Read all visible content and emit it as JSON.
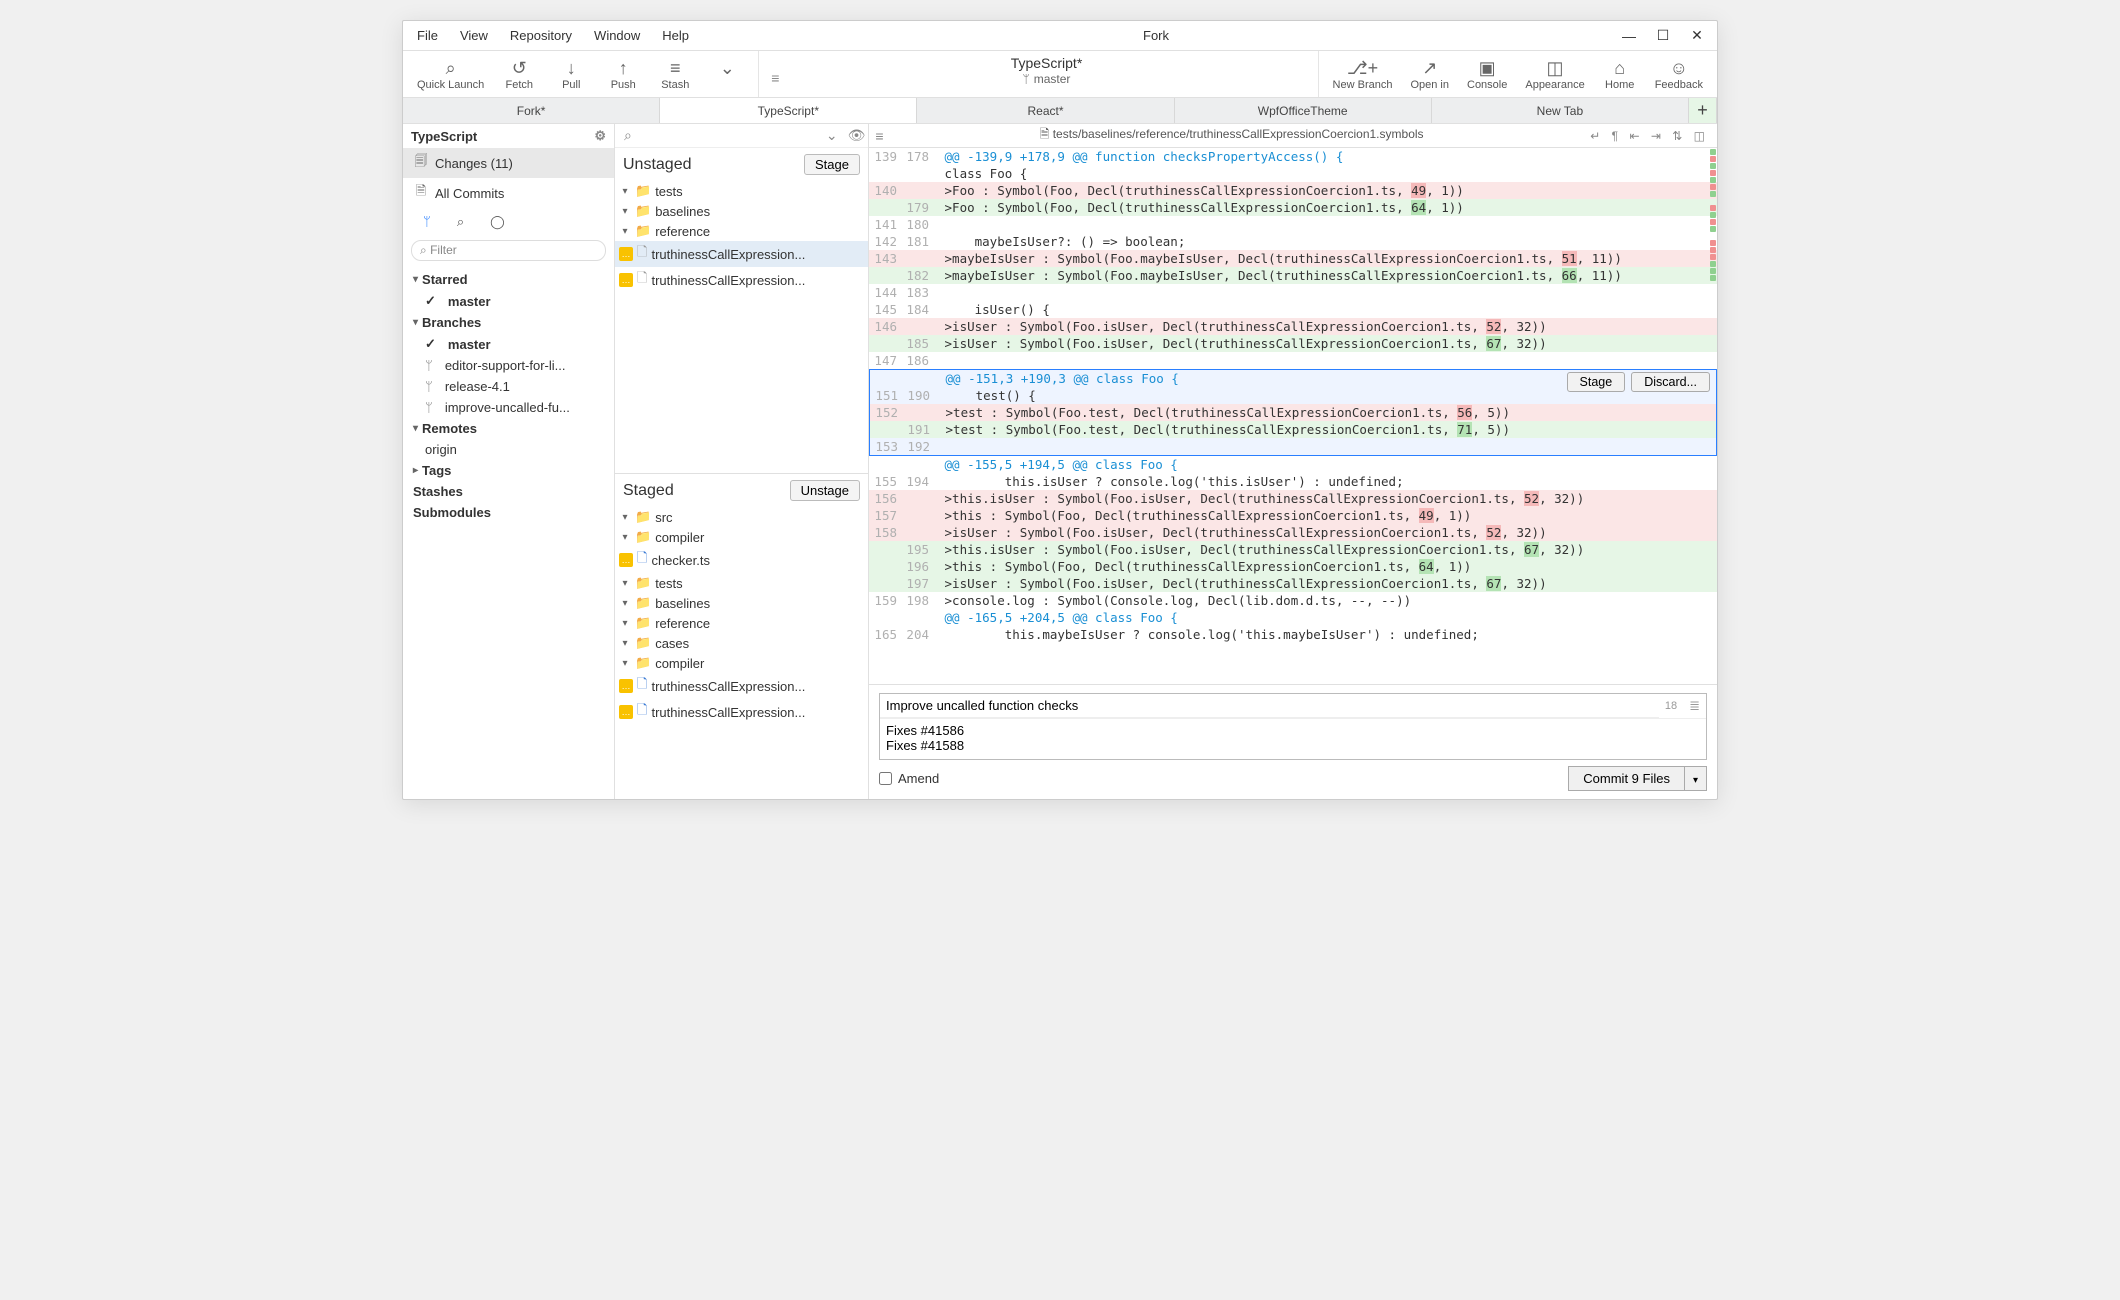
{
  "menu": [
    "File",
    "View",
    "Repository",
    "Window",
    "Help"
  ],
  "window_title": "Fork",
  "toolbar_left": [
    {
      "icon": "⌕",
      "label": "Quick Launch"
    },
    {
      "icon": "↺",
      "label": "Fetch"
    },
    {
      "icon": "↓",
      "label": "Pull"
    },
    {
      "icon": "↑",
      "label": "Push"
    },
    {
      "icon": "≡",
      "label": "Stash"
    }
  ],
  "repo_title": "TypeScript*",
  "repo_branch": "master",
  "toolbar_right": [
    {
      "icon": "⎇+",
      "label": "New Branch"
    },
    {
      "icon": "↗",
      "label": "Open in"
    },
    {
      "icon": "▣",
      "label": "Console"
    },
    {
      "icon": "◫",
      "label": "Appearance"
    },
    {
      "icon": "⌂",
      "label": "Home"
    },
    {
      "icon": "☺",
      "label": "Feedback"
    }
  ],
  "tabs": [
    "Fork*",
    "TypeScript*",
    "React*",
    "WpfOfficeTheme",
    "New Tab"
  ],
  "active_tab": 1,
  "sidebar": {
    "title": "TypeScript",
    "changes_label": "Changes (11)",
    "allcommits_label": "All Commits",
    "filter_placeholder": "Filter",
    "groups": [
      {
        "name": "Starred",
        "items": [
          {
            "label": "master",
            "bold": true,
            "icon": "check"
          }
        ]
      },
      {
        "name": "Branches",
        "items": [
          {
            "label": "master",
            "bold": true,
            "icon": "check"
          },
          {
            "label": "editor-support-for-li...",
            "icon": "branch"
          },
          {
            "label": "release-4.1",
            "icon": "branch"
          },
          {
            "label": "improve-uncalled-fu...",
            "icon": "branch"
          }
        ]
      },
      {
        "name": "Remotes",
        "items": [
          {
            "label": "origin",
            "icon": "remote"
          }
        ]
      },
      {
        "name": "Tags",
        "items": [],
        "collapsed": true
      },
      {
        "name": "Stashes",
        "items": [],
        "static": true
      },
      {
        "name": "Submodules",
        "items": [],
        "static": true
      }
    ]
  },
  "unstaged": {
    "title": "Unstaged",
    "button": "Stage",
    "tree": [
      {
        "ind": 0,
        "t": "folder",
        "label": "tests"
      },
      {
        "ind": 1,
        "t": "folder",
        "label": "baselines"
      },
      {
        "ind": 2,
        "t": "folder",
        "label": "reference"
      },
      {
        "ind": 3,
        "t": "mfile",
        "label": "truthinessCallExpression...",
        "sel": true
      },
      {
        "ind": 3,
        "t": "mfile",
        "label": "truthinessCallExpression..."
      }
    ]
  },
  "staged": {
    "title": "Staged",
    "button": "Unstage",
    "tree": [
      {
        "ind": 0,
        "t": "folder",
        "label": "src"
      },
      {
        "ind": 1,
        "t": "folder",
        "label": "compiler"
      },
      {
        "ind": 2,
        "t": "mfile-blue",
        "label": "checker.ts"
      },
      {
        "ind": 0,
        "t": "folder",
        "label": "tests"
      },
      {
        "ind": 1,
        "t": "folder",
        "label": "baselines"
      },
      {
        "ind": 2,
        "t": "folder",
        "label": "reference"
      },
      {
        "ind": 1,
        "t": "folder",
        "label": "cases"
      },
      {
        "ind": 2,
        "t": "folder",
        "label": "compiler"
      },
      {
        "ind": 3,
        "t": "mfile-blue",
        "label": "truthinessCallExpression..."
      },
      {
        "ind": 3,
        "t": "mfile-blue",
        "label": "truthinessCallExpression..."
      }
    ]
  },
  "file_path": "tests/baselines/reference/truthinessCallExpressionCoercion1.symbols",
  "diff": [
    {
      "lo": 139,
      "ln": 178,
      "cls": "hunk",
      "text": " @@ -139,9 +178,9 @@ function checksPropertyAccess() {"
    },
    {
      "lo": "",
      "ln": "",
      "cls": "",
      "text": " class Foo {"
    },
    {
      "lo": 140,
      "ln": "",
      "cls": "del",
      "text": " >Foo : Symbol(Foo, Decl(truthinessCallExpressionCoercion1.ts, 49, 1))",
      "hl": "49"
    },
    {
      "lo": "",
      "ln": 179,
      "cls": "add",
      "text": " >Foo : Symbol(Foo, Decl(truthinessCallExpressionCoercion1.ts, 64, 1))",
      "hl": "64"
    },
    {
      "lo": 141,
      "ln": 180,
      "cls": "",
      "text": ""
    },
    {
      "lo": 142,
      "ln": 181,
      "cls": "",
      "text": "     maybeIsUser?: () => boolean;"
    },
    {
      "lo": 143,
      "ln": "",
      "cls": "del",
      "text": " >maybeIsUser : Symbol(Foo.maybeIsUser, Decl(truthinessCallExpressionCoercion1.ts, 51, 11))",
      "hl": "51"
    },
    {
      "lo": "",
      "ln": 182,
      "cls": "add",
      "text": " >maybeIsUser : Symbol(Foo.maybeIsUser, Decl(truthinessCallExpressionCoercion1.ts, 66, 11))",
      "hl": "66"
    },
    {
      "lo": 144,
      "ln": 183,
      "cls": "",
      "text": ""
    },
    {
      "lo": 145,
      "ln": 184,
      "cls": "",
      "text": "     isUser() {"
    },
    {
      "lo": 146,
      "ln": "",
      "cls": "del",
      "text": " >isUser : Symbol(Foo.isUser, Decl(truthinessCallExpressionCoercion1.ts, 52, 32))",
      "hl": "52"
    },
    {
      "lo": "",
      "ln": 185,
      "cls": "add",
      "text": " >isUser : Symbol(Foo.isUser, Decl(truthinessCallExpressionCoercion1.ts, 67, 32))",
      "hl": "67"
    },
    {
      "lo": 147,
      "ln": 186,
      "cls": "",
      "text": ""
    }
  ],
  "diff_selected": [
    {
      "lo": "",
      "ln": "",
      "cls": "hunk",
      "text": " @@ -151,3 +190,3 @@ class Foo {"
    },
    {
      "lo": 151,
      "ln": 190,
      "cls": "",
      "text": "     test() {"
    },
    {
      "lo": 152,
      "ln": "",
      "cls": "del",
      "text": " >test : Symbol(Foo.test, Decl(truthinessCallExpressionCoercion1.ts, 56, 5))",
      "hl": "56"
    },
    {
      "lo": "",
      "ln": 191,
      "cls": "add",
      "text": " >test : Symbol(Foo.test, Decl(truthinessCallExpressionCoercion1.ts, 71, 5))",
      "hl": "71"
    },
    {
      "lo": 153,
      "ln": 192,
      "cls": "",
      "text": ""
    }
  ],
  "diff_after": [
    {
      "lo": "",
      "ln": "",
      "cls": "hunk",
      "text": " @@ -155,5 +194,5 @@ class Foo {"
    },
    {
      "lo": 155,
      "ln": 194,
      "cls": "",
      "text": "         this.isUser ? console.log('this.isUser') : undefined;"
    },
    {
      "lo": 156,
      "ln": "",
      "cls": "del",
      "text": " >this.isUser : Symbol(Foo.isUser, Decl(truthinessCallExpressionCoercion1.ts, 52, 32))",
      "hl": "52"
    },
    {
      "lo": 157,
      "ln": "",
      "cls": "del",
      "text": " >this : Symbol(Foo, Decl(truthinessCallExpressionCoercion1.ts, 49, 1))",
      "hl": "49"
    },
    {
      "lo": 158,
      "ln": "",
      "cls": "del",
      "text": " >isUser : Symbol(Foo.isUser, Decl(truthinessCallExpressionCoercion1.ts, 52, 32))",
      "hl": "52"
    },
    {
      "lo": "",
      "ln": 195,
      "cls": "add",
      "text": " >this.isUser : Symbol(Foo.isUser, Decl(truthinessCallExpressionCoercion1.ts, 67, 32))",
      "hl": "67"
    },
    {
      "lo": "",
      "ln": 196,
      "cls": "add",
      "text": " >this : Symbol(Foo, Decl(truthinessCallExpressionCoercion1.ts, 64, 1))",
      "hl": "64"
    },
    {
      "lo": "",
      "ln": 197,
      "cls": "add",
      "text": " >isUser : Symbol(Foo.isUser, Decl(truthinessCallExpressionCoercion1.ts, 67, 32))",
      "hl": "67"
    },
    {
      "lo": 159,
      "ln": 198,
      "cls": "",
      "text": " >console.log : Symbol(Console.log, Decl(lib.dom.d.ts, --, --))"
    },
    {
      "lo": "",
      "ln": "",
      "cls": "hunk",
      "text": " @@ -165,5 +204,5 @@ class Foo {"
    },
    {
      "lo": 165,
      "ln": 204,
      "cls": "",
      "text": "         this.maybeIsUser ? console.log('this.maybeIsUser') : undefined;"
    }
  ],
  "selected_buttons": {
    "stage": "Stage",
    "discard": "Discard..."
  },
  "commit": {
    "subject": "Improve uncalled function checks",
    "count": "18",
    "body": "Fixes #41586\nFixes #41588",
    "amend_label": "Amend",
    "button": "Commit 9 Files"
  }
}
